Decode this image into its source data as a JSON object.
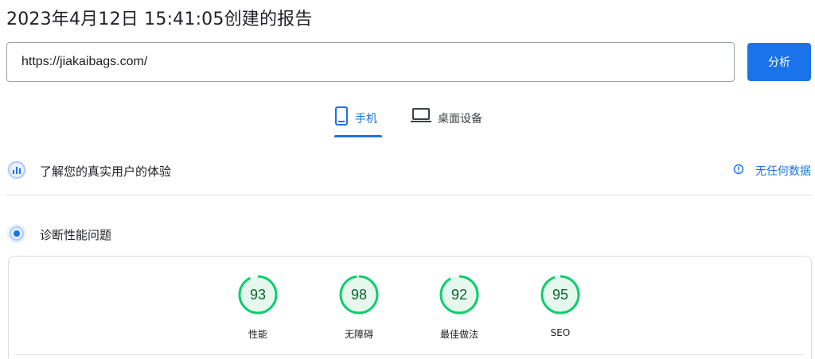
{
  "report": {
    "title": "2023年4月12日 15:41:05创建的报告"
  },
  "search": {
    "url_value": "https://jiakaibags.com/",
    "analyze_label": "分析"
  },
  "tabs": [
    {
      "label": "手机",
      "icon": "smartphone-icon",
      "active": true
    },
    {
      "label": "桌面设备",
      "icon": "laptop-icon",
      "active": false
    }
  ],
  "field_data": {
    "label": "了解您的真实用户的体验",
    "icon": "field-data-icon",
    "status": "无任何数据",
    "status_icon": "info-icon"
  },
  "diagnostics": {
    "label": "诊断性能问题",
    "icon": "lab-data-icon"
  },
  "scores": [
    {
      "label": "性能",
      "value": "93"
    },
    {
      "label": "无障碍",
      "value": "98"
    },
    {
      "label": "最佳做法",
      "value": "92"
    },
    {
      "label": "SEO",
      "value": "95"
    }
  ],
  "colors": {
    "accent": "#1a73e8",
    "pass_ring": "#0cce6b",
    "pass_fill": "#e6f8ee",
    "pass_text": "#0d652d"
  }
}
